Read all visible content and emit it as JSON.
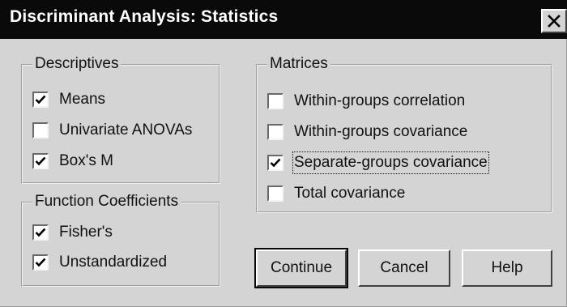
{
  "window": {
    "title": "Discriminant Analysis: Statistics",
    "close_icon": "close-x-icon"
  },
  "descriptives": {
    "title": "Descriptives",
    "items": [
      {
        "label": "Means",
        "checked": true
      },
      {
        "label": "Univariate ANOVAs",
        "checked": false
      },
      {
        "label": "Box's M",
        "checked": true
      }
    ]
  },
  "function_coefficients": {
    "title": "Function Coefficients",
    "items": [
      {
        "label": "Fisher's",
        "checked": true
      },
      {
        "label": "Unstandardized",
        "checked": true
      }
    ]
  },
  "matrices": {
    "title": "Matrices",
    "items": [
      {
        "label": "Within-groups correlation",
        "checked": false
      },
      {
        "label": "Within-groups covariance",
        "checked": false
      },
      {
        "label": "Separate-groups covariance",
        "checked": true
      },
      {
        "label": "Total covariance",
        "checked": false
      }
    ]
  },
  "buttons": {
    "continue": "Continue",
    "cancel": "Cancel",
    "help": "Help"
  },
  "colors": {
    "titlebar": "#0a0a0a",
    "dialog_face": "#d4d4d4",
    "title_text": "#ffffff"
  }
}
